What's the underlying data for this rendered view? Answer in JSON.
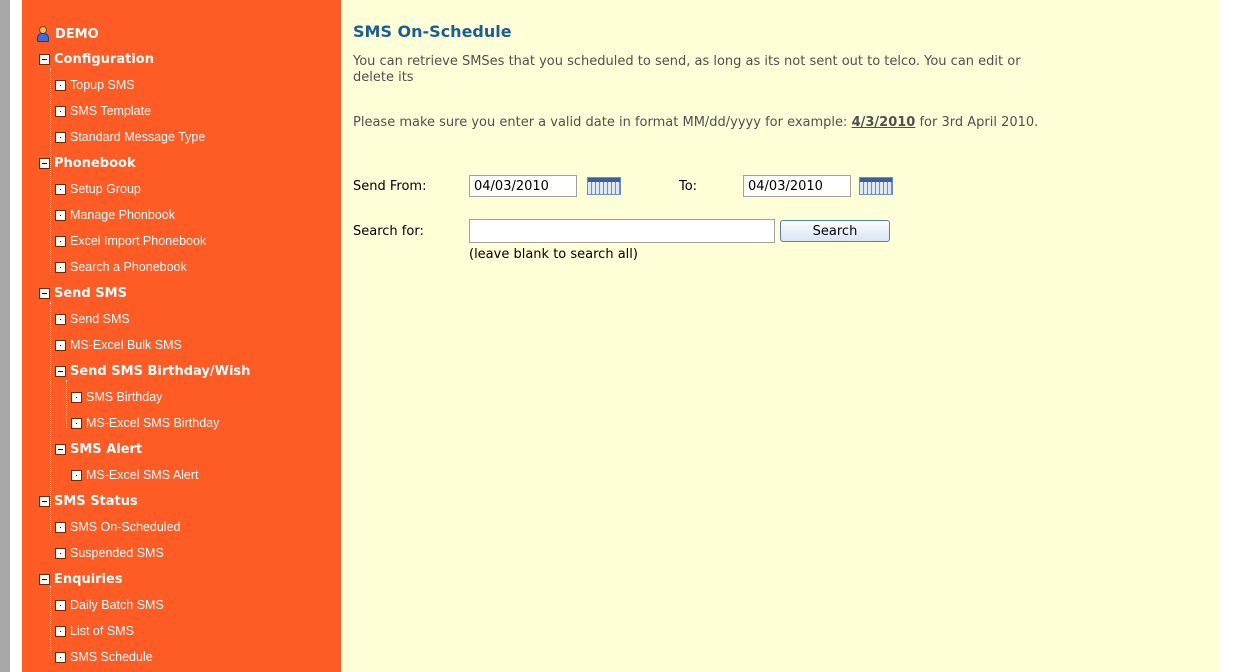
{
  "sidebar": {
    "root": "DEMO",
    "configuration": {
      "label": "Configuration",
      "items": [
        "Topup SMS",
        "SMS Template",
        "Standard Message Type"
      ]
    },
    "phonebook": {
      "label": "Phonebook",
      "items": [
        "Setup Group",
        "Manage Phonbook",
        "Excel Import Phonebook",
        "Search a Phonebook"
      ]
    },
    "send_sms": {
      "label": "Send SMS",
      "items": [
        "Send SMS",
        "MS-Excel Bulk SMS"
      ],
      "birthday": {
        "label": "Send SMS Birthday/Wish",
        "items": [
          "SMS Birthday",
          "MS-Excel SMS Birthday"
        ]
      },
      "alert": {
        "label": "SMS Alert",
        "items": [
          "MS-Excel SMS Alert"
        ]
      }
    },
    "status": {
      "label": "SMS Status",
      "items": [
        "SMS On-Scheduled",
        "Suspended SMS"
      ]
    },
    "enquiries": {
      "label": "Enquiries",
      "items": [
        "Daily Batch SMS",
        "List of SMS",
        "SMS Schedule"
      ]
    }
  },
  "main": {
    "title": "SMS On-Schedule",
    "para1_line1": "You can retrieve SMSes that you scheduled to send, as long as its not sent out to telco. You can edit or",
    "para1_line2": "delete its",
    "para2_prefix": "Please make sure you enter a valid date in format MM/dd/yyyy for example: ",
    "para2_example": "4/3/2010",
    "para2_suffix": " for 3rd April 2010.",
    "form": {
      "send_from_label": "Send From:",
      "send_from_value": "04/03/2010",
      "to_label": "To:",
      "to_value": "04/03/2010",
      "search_for_label": "Search for:",
      "search_value": "",
      "search_button": "Search",
      "hint": "(leave blank to search all)"
    }
  },
  "colors": {
    "sidebar_bg": "#fe5b25",
    "main_bg": "#ffffd8",
    "title": "#1a5f93"
  }
}
